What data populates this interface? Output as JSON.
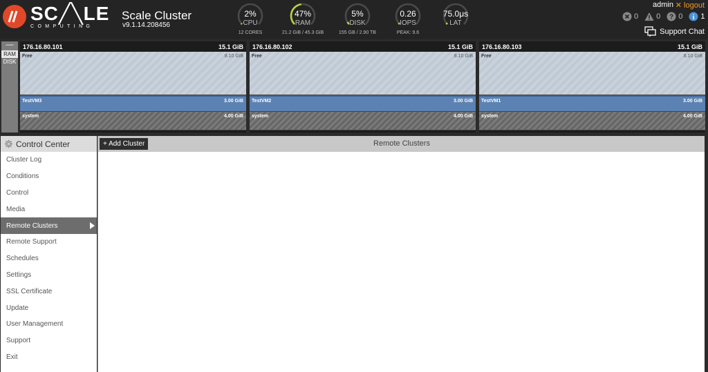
{
  "brand": {
    "word": "SC╱╲LE",
    "sub": "COMPUTING"
  },
  "cluster": {
    "name": "Scale Cluster",
    "version": "v9.1.14.208456"
  },
  "gauges": [
    {
      "value": "2%",
      "label": "CPU",
      "sub": "12 CORES",
      "fraction": 0.02
    },
    {
      "value": "47%",
      "label": "RAM",
      "sub": "21.2 GiB / 45.3 GiB",
      "fraction": 0.47
    },
    {
      "value": "5%",
      "label": "DISK",
      "sub": "155 GB / 2.90 TB",
      "fraction": 0.05
    },
    {
      "value": "0.26",
      "label": "IOPS",
      "sub": "PEAK: 9.6",
      "fraction": 0.03
    },
    {
      "value": "75.0μs",
      "label": "LAT",
      "sub": "",
      "fraction": 0.03
    }
  ],
  "alerts": {
    "errors": "0",
    "warnings": "0",
    "questions": "0",
    "info": "1"
  },
  "user": {
    "name": "admin",
    "logout": "✕ logout",
    "support": "Support Chat"
  },
  "resource_tabs": {
    "collapse": "—",
    "ram": "RAM",
    "disk": "DISK"
  },
  "nodes": [
    {
      "ip": "176.16.80.101",
      "total": "15.1 GiB",
      "free_label": "Free",
      "free": "8.10 GiB",
      "vm": "TestVM3",
      "vm_size": "3.00 GiB",
      "sys": "system",
      "sys_size": "4.00 GiB"
    },
    {
      "ip": "176.16.80.102",
      "total": "15.1 GiB",
      "free_label": "Free",
      "free": "8.10 GiB",
      "vm": "TestVM2",
      "vm_size": "3.00 GiB",
      "sys": "system",
      "sys_size": "4.00 GiB"
    },
    {
      "ip": "176.16.80.103",
      "total": "15.1 GiB",
      "free_label": "Free",
      "free": "8.10 GiB",
      "vm": "TestVM1",
      "vm_size": "3.00 GiB",
      "sys": "system",
      "sys_size": "4.00 GiB"
    }
  ],
  "sidebar": {
    "title": "Control Center",
    "items": [
      {
        "label": "Cluster Log"
      },
      {
        "label": "Conditions"
      },
      {
        "label": "Control"
      },
      {
        "label": "Media"
      },
      {
        "label": "Remote Clusters",
        "active": true
      },
      {
        "label": "Remote Support"
      },
      {
        "label": "Schedules"
      },
      {
        "label": "Settings"
      },
      {
        "label": "SSL Certificate"
      },
      {
        "label": "Update"
      },
      {
        "label": "User Management"
      },
      {
        "label": "Support"
      },
      {
        "label": "Exit"
      }
    ]
  },
  "main": {
    "add_label": "+ Add Cluster",
    "title": "Remote Clusters"
  },
  "colors": {
    "accent": "#e0482a",
    "logout": "#f29b26",
    "gauge_ring": "#b9d341",
    "vm": "#5b82b3"
  }
}
